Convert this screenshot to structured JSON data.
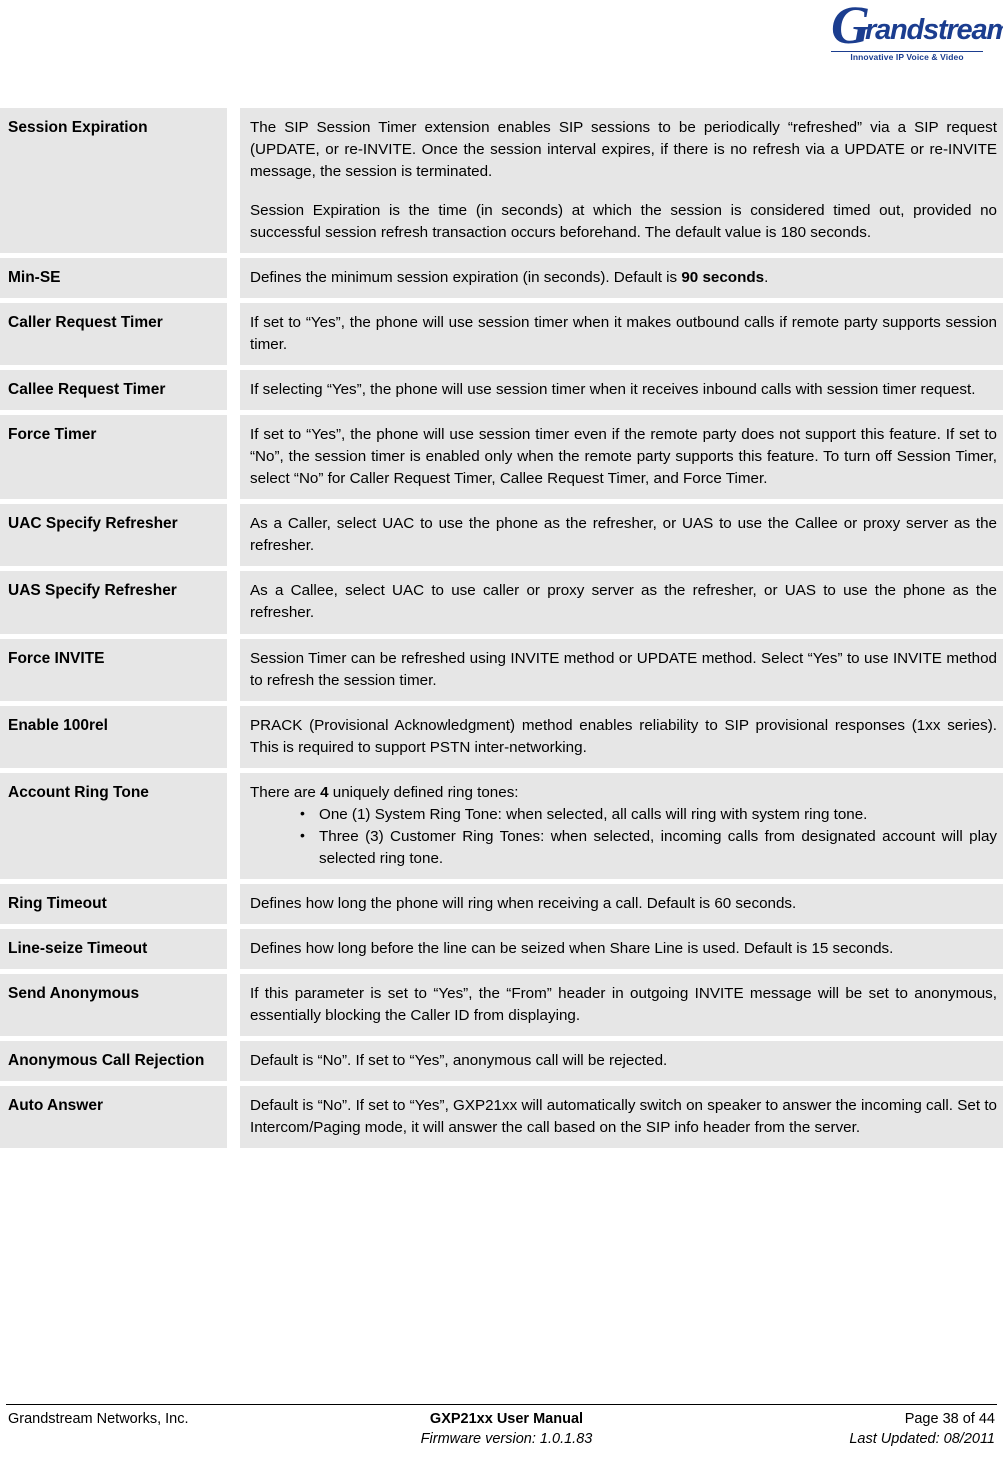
{
  "header": {
    "logo": {
      "initial": "G",
      "wordmark": "randstream",
      "tagline": "Innovative IP Voice & Video",
      "color": "#1b3d8f"
    }
  },
  "table": {
    "rows": [
      {
        "label": "Session Expiration",
        "paragraphs": [
          "The SIP Session Timer extension enables SIP sessions to be periodically “refreshed” via a SIP request (UPDATE, or re-INVITE. Once the session interval expires, if there is no refresh via a UPDATE or re-INVITE message, the session is terminated.",
          "Session Expiration is the time (in seconds) at which the session is considered timed out, provided no successful session refresh transaction occurs beforehand. The default value is 180 seconds."
        ]
      },
      {
        "label": "Min-SE",
        "prefix": "Defines the minimum session expiration (in seconds). Default is ",
        "bold": "90 seconds",
        "suffix": "."
      },
      {
        "label": "Caller Request Timer",
        "paragraphs": [
          "If set to “Yes”, the phone will use session timer when it makes outbound calls if remote party supports session timer."
        ]
      },
      {
        "label": "Callee Request Timer",
        "paragraphs": [
          "If selecting “Yes”, the phone will use session timer when it receives inbound calls with session timer request."
        ]
      },
      {
        "label": "Force Timer",
        "paragraphs": [
          "If set to “Yes”, the phone will use session timer even if the remote party does not support this feature. If set to “No”, the session timer is enabled only when the remote party supports this feature. To turn off Session Timer, select “No” for Caller Request Timer, Callee Request Timer, and Force Timer."
        ]
      },
      {
        "label": "UAC Specify Refresher",
        "paragraphs": [
          "As a Caller, select UAC to use the phone as the refresher, or UAS to use the Callee or proxy server as the refresher."
        ]
      },
      {
        "label": "UAS Specify Refresher",
        "paragraphs": [
          "As a Callee, select UAC to use caller or proxy server as the refresher, or UAS to use the phone as the refresher."
        ]
      },
      {
        "label": "Force INVITE",
        "paragraphs": [
          "Session Timer can be refreshed using INVITE method or UPDATE method. Select “Yes” to use INVITE method to refresh the session timer."
        ]
      },
      {
        "label": "Enable 100rel",
        "paragraphs": [
          "PRACK (Provisional Acknowledgment) method enables reliability to SIP provisional responses (1xx series). This is required to support PSTN inter-networking."
        ]
      },
      {
        "label": "Account Ring Tone",
        "intro_prefix": "There are ",
        "intro_bold": "4",
        "intro_suffix": " uniquely defined ring tones:",
        "bullets": [
          "One (1) System Ring Tone: when selected, all calls will ring with system ring tone.",
          "Three (3) Customer Ring Tones: when selected, incoming calls from designated account will play selected ring tone."
        ]
      },
      {
        "label": "Ring Timeout",
        "paragraphs": [
          "Defines how long the phone will ring when receiving a call. Default is 60 seconds."
        ]
      },
      {
        "label": "Line-seize Timeout",
        "paragraphs": [
          "Defines how long before the line can be seized when Share Line is used. Default is 15 seconds."
        ]
      },
      {
        "label": "Send Anonymous",
        "paragraphs": [
          "If this parameter is set to “Yes”, the “From” header in outgoing INVITE message will be set to anonymous, essentially blocking the Caller ID from displaying."
        ]
      },
      {
        "label": "Anonymous Call Rejection",
        "paragraphs": [
          "Default is “No”. If set to “Yes”, anonymous call will be rejected."
        ]
      },
      {
        "label": "Auto Answer",
        "paragraphs": [
          "Default is “No”. If set to “Yes”, GXP21xx will automatically switch on speaker to answer the incoming call. Set to Intercom/Paging mode, it will answer the call based on the SIP info header from the server."
        ]
      }
    ]
  },
  "footer": {
    "company": "Grandstream Networks, Inc.",
    "manual_title": "GXP21xx User Manual",
    "firmware": "Firmware version: 1.0.1.83",
    "page": "Page 38 of 44",
    "last_updated": "Last Updated:  08/2011"
  }
}
